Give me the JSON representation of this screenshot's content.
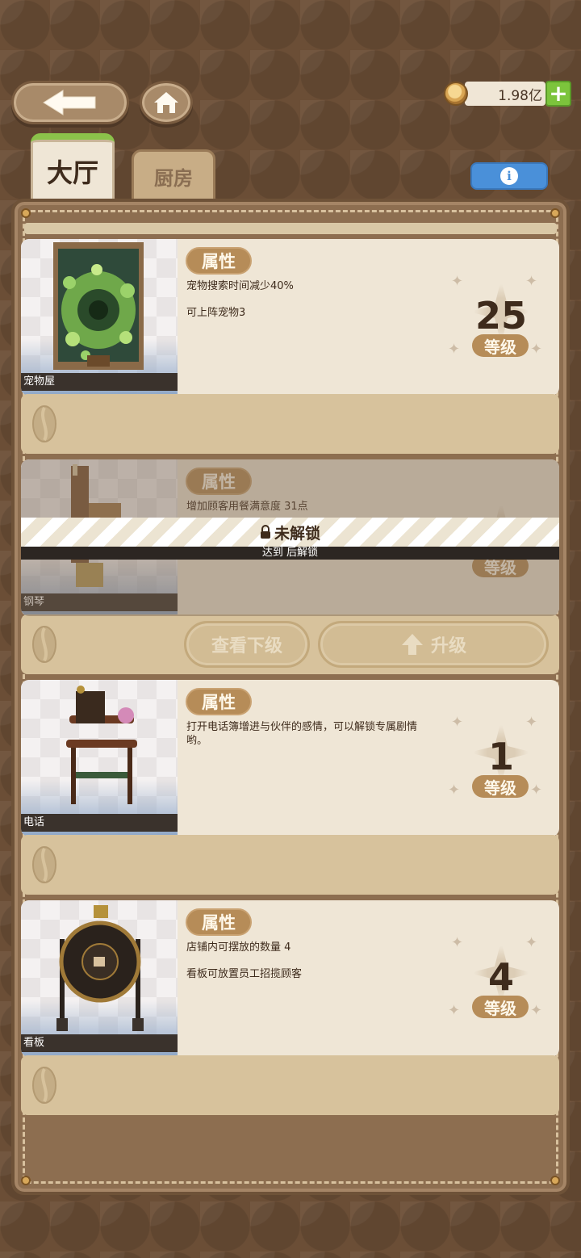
{
  "header": {
    "currency_value": "1.98亿",
    "add_symbol": "+"
  },
  "tabs": [
    {
      "label": "大厅",
      "active": true
    },
    {
      "label": "厨房",
      "active": false
    }
  ],
  "info_symbol": "i",
  "items": [
    {
      "name": "宠物屋",
      "attr_label": "属性",
      "desc": [
        "宠物搜索时间减少40%",
        "可上阵宠物3"
      ],
      "level": "25",
      "level_label": "等级",
      "locked": false
    },
    {
      "name": "钢琴",
      "attr_label": "属性",
      "desc": [
        "增加顾客用餐满意度 31点"
      ],
      "level": "",
      "level_label": "等级",
      "locked": true,
      "lock_title": "未解锁",
      "lock_hint": "达到 后解锁",
      "btn_view_next": "查看下级",
      "btn_upgrade": "升级"
    },
    {
      "name": "电话",
      "attr_label": "属性",
      "desc": [
        "打开电话簿增进与伙伴的感情，可以解锁专属剧情哟。"
      ],
      "level": "1",
      "level_label": "等级",
      "locked": false
    },
    {
      "name": "看板",
      "attr_label": "属性",
      "desc": [
        "店铺内可摆放的数量 4",
        "看板可放置员工招揽顾客"
      ],
      "level": "4",
      "level_label": "等级",
      "locked": false
    }
  ],
  "colors": {
    "background": "#6b4e36",
    "card": "#efe6d6",
    "badge": "#b68c58",
    "tab_active_accent": "#8bc24a",
    "info_button": "#4a90d9",
    "plus_button": "#7cc43c"
  },
  "icons": [
    "back-arrow-icon",
    "home-icon",
    "coin-icon",
    "plus-icon",
    "info-icon",
    "lock-icon",
    "coffee-bean-icon",
    "upgrade-arrow-icon",
    "sparkle-icon"
  ]
}
